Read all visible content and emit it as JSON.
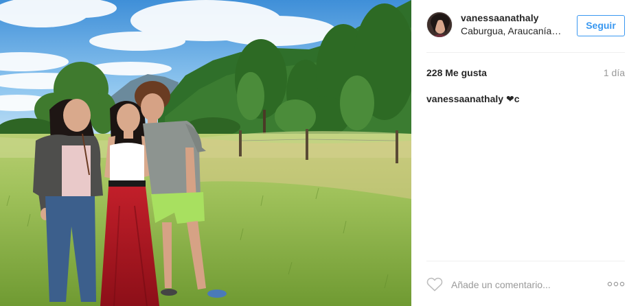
{
  "post": {
    "username": "vanessaanathaly",
    "location": "Caburgua, Araucanía, Chile",
    "follow_label": "Seguir",
    "likes": "228 Me gusta",
    "time": "1 día",
    "caption": {
      "username": "vanessaanathaly",
      "text": " ❤c"
    },
    "comment_placeholder": "Añade un comentario...",
    "photo_alt": "Foto de la publicación",
    "icons": {
      "like": "heart-outline-icon",
      "more": "more-options-icon"
    }
  },
  "colors": {
    "accent": "#3897f0",
    "text": "#262626",
    "muted": "#999999",
    "divider": "#efefef"
  }
}
